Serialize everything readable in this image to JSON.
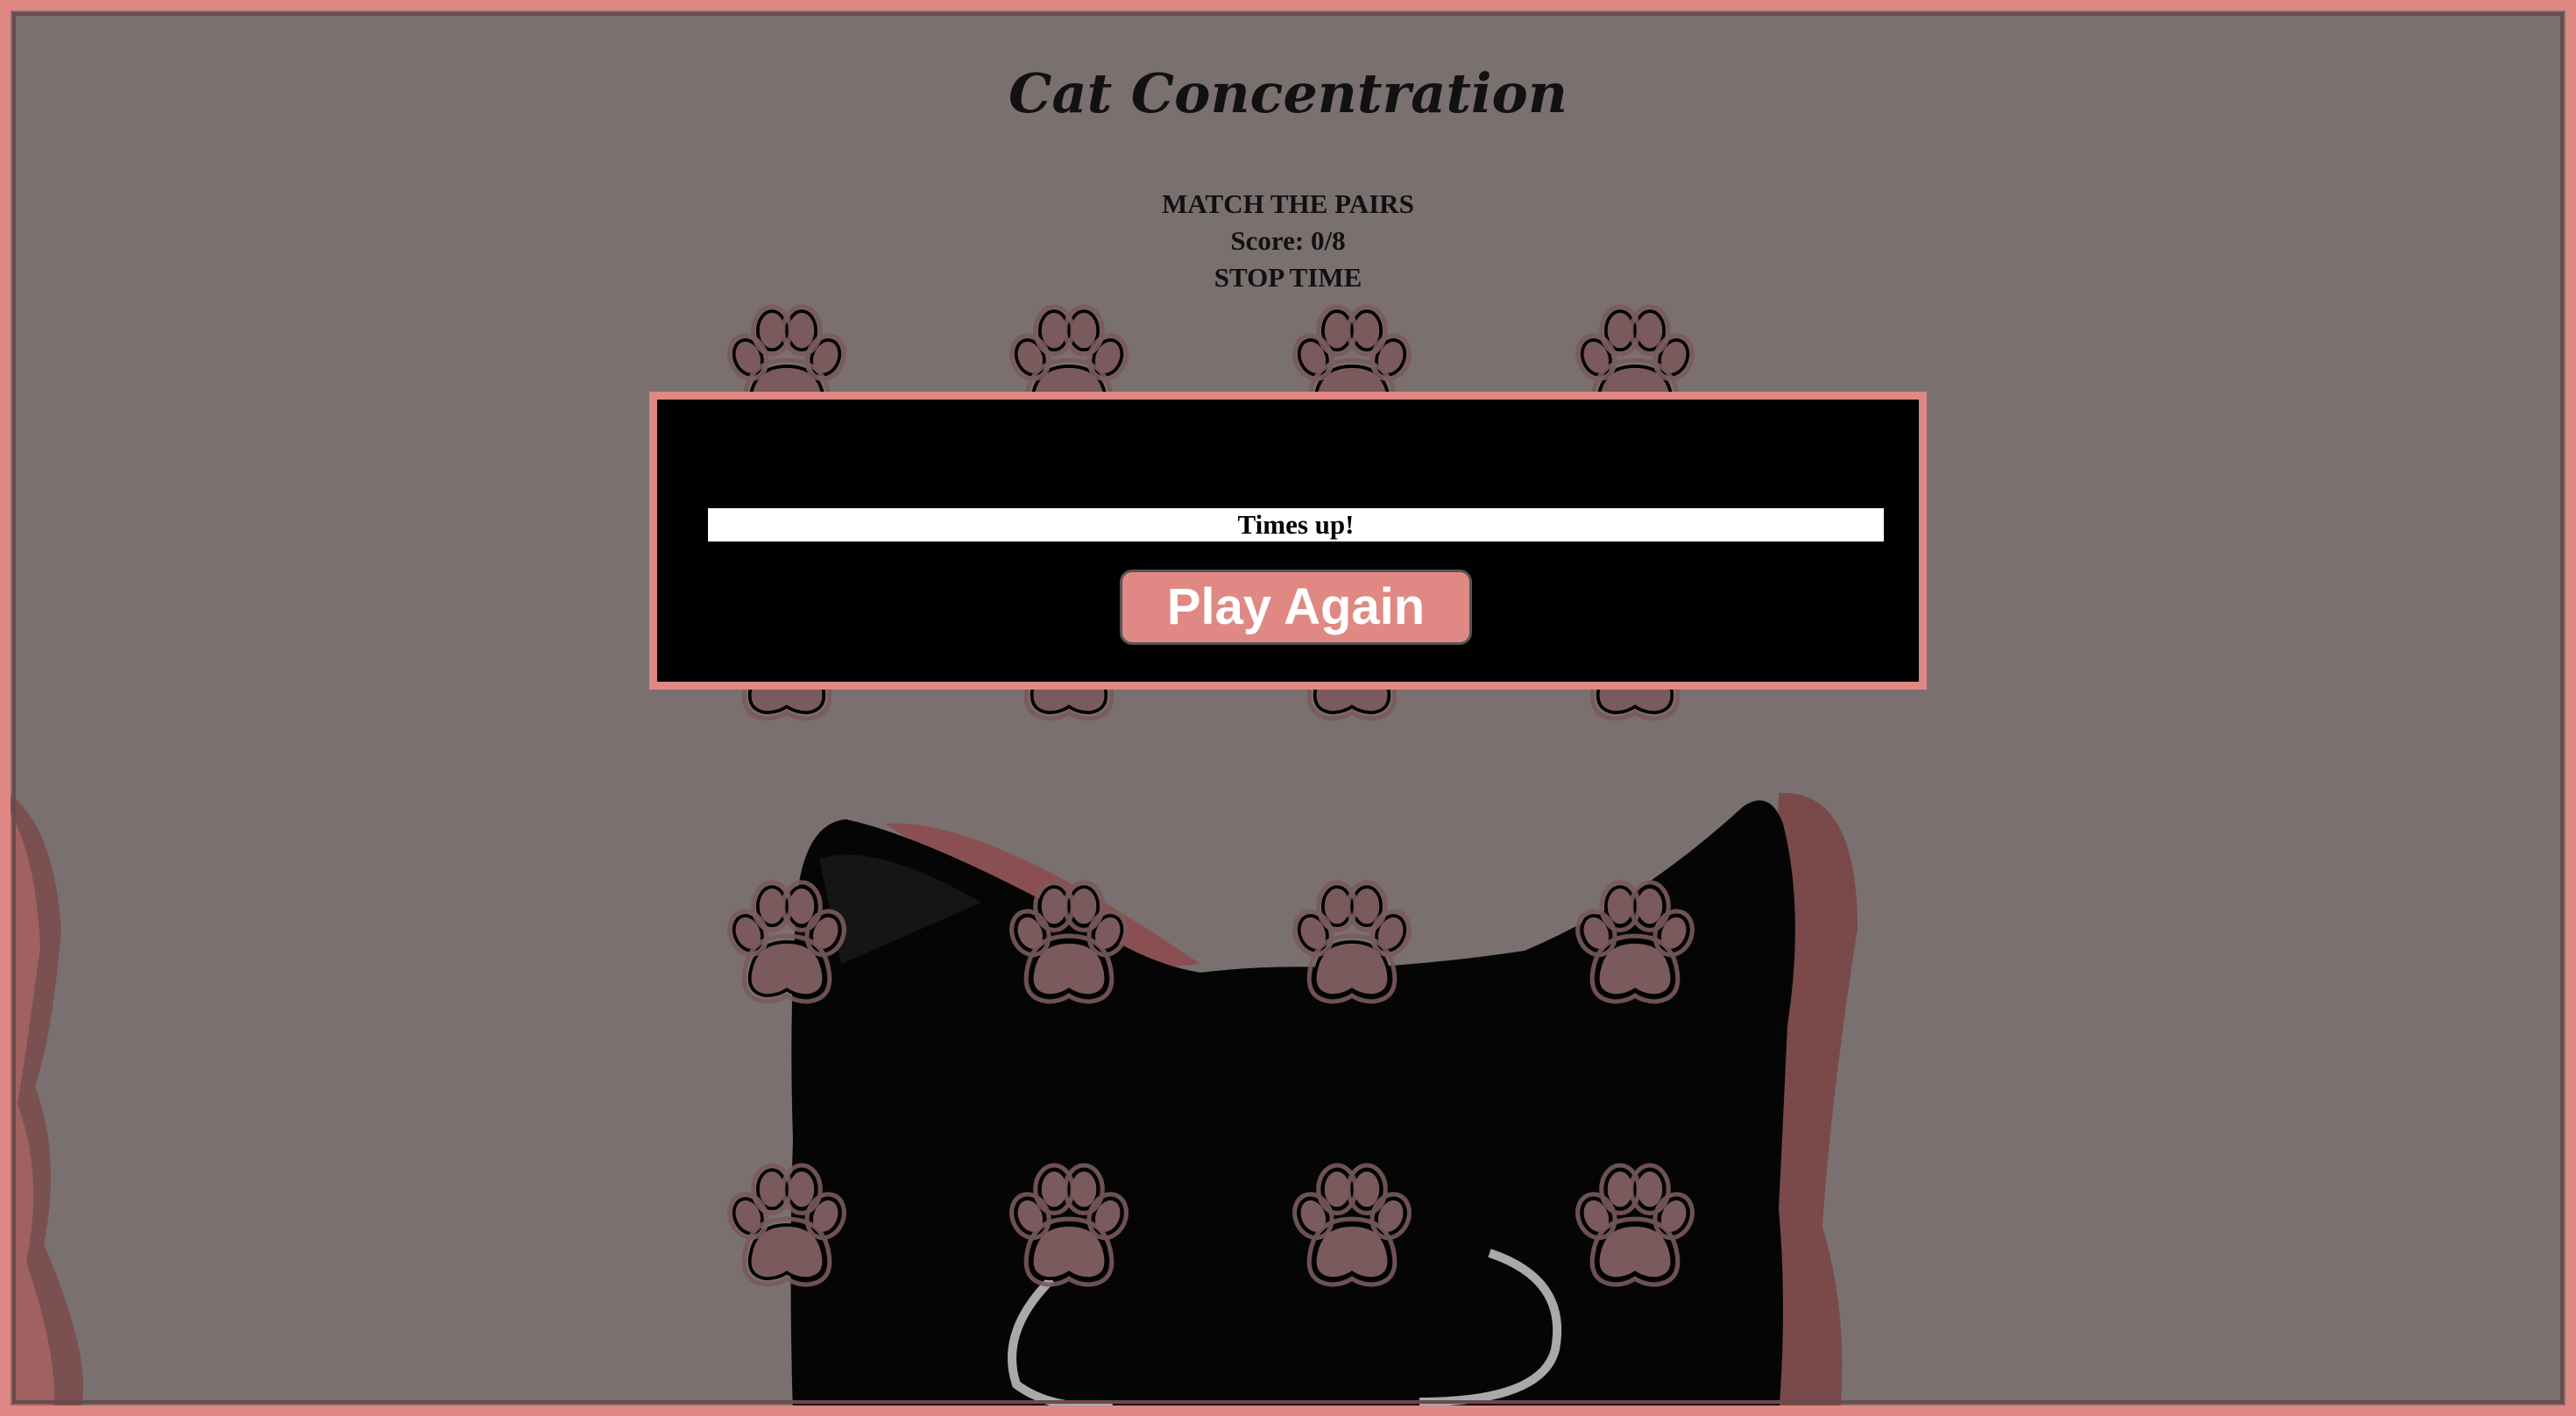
{
  "game": {
    "title": "Cat Concentration",
    "instructions": "MATCH THE PAIRS",
    "score_label": "Score: 0/8",
    "timer_button": "STOP TIME"
  },
  "modal": {
    "message": "Times up!",
    "play_again_label": "Play Again"
  },
  "board": {
    "rows": 4,
    "columns": 4,
    "card_back_icon": "paw-print-icon",
    "background_image": "black-cat-head"
  },
  "colors": {
    "accent": "#df8884",
    "background": "#7a7070",
    "card_paw": "#7a5a5c",
    "modal_bg": "#000000"
  }
}
